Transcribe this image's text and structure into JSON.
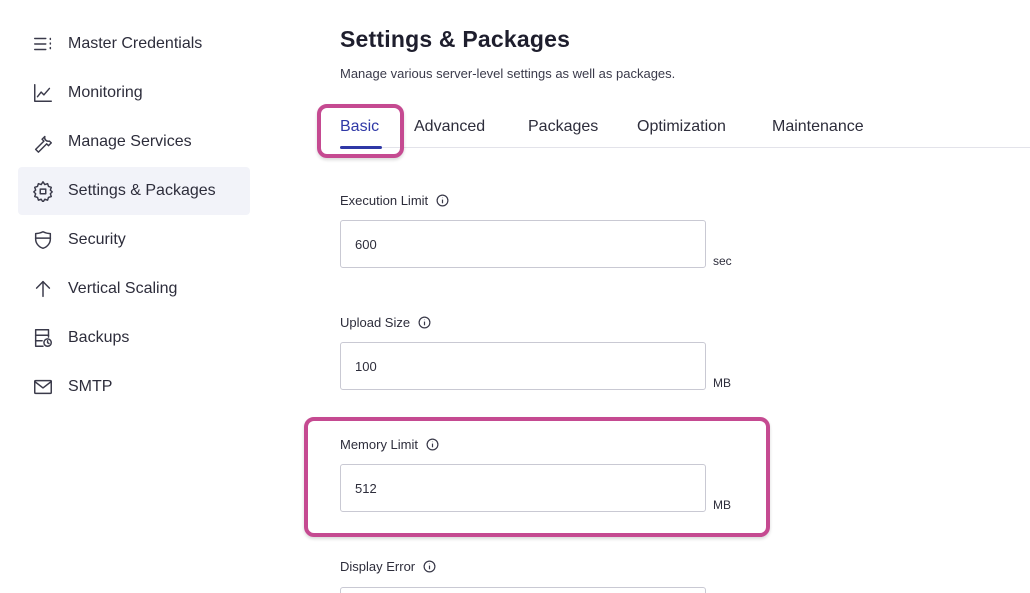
{
  "sidebar": {
    "items": [
      {
        "label": "Master Credentials",
        "icon": "list-icon",
        "active": false
      },
      {
        "label": "Monitoring",
        "icon": "line-chart-icon",
        "active": false
      },
      {
        "label": "Manage Services",
        "icon": "wrench-icon",
        "active": false
      },
      {
        "label": "Settings & Packages",
        "icon": "gear-box-icon",
        "active": true
      },
      {
        "label": "Security",
        "icon": "shield-icon",
        "active": false
      },
      {
        "label": "Vertical Scaling",
        "icon": "arrow-up-icon",
        "active": false
      },
      {
        "label": "Backups",
        "icon": "backup-icon",
        "active": false
      },
      {
        "label": "SMTP",
        "icon": "mail-icon",
        "active": false
      }
    ]
  },
  "main": {
    "title": "Settings & Packages",
    "subtitle": "Manage various server-level settings as well as packages.",
    "tabs": [
      {
        "label": "Basic",
        "active": true
      },
      {
        "label": "Advanced",
        "active": false
      },
      {
        "label": "Packages",
        "active": false
      },
      {
        "label": "Optimization",
        "active": false
      },
      {
        "label": "Maintenance",
        "active": false
      }
    ],
    "fields": [
      {
        "label": "Execution Limit",
        "value": "600",
        "unit": "sec"
      },
      {
        "label": "Upload Size",
        "value": "100",
        "unit": "MB"
      },
      {
        "label": "Memory Limit",
        "value": "512",
        "unit": "MB"
      },
      {
        "label": "Display Error",
        "value": "",
        "unit": ""
      }
    ]
  },
  "colors": {
    "accent": "#2f38a6",
    "highlight": "#c54a91",
    "active_nav_bg": "#f2f3f9"
  }
}
